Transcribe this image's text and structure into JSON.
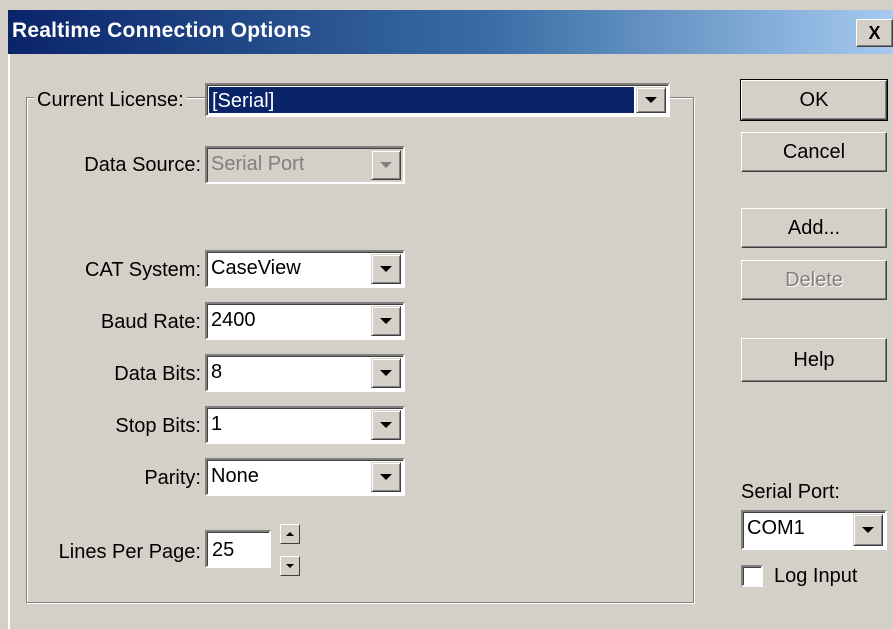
{
  "window": {
    "title": "Realtime Connection Options",
    "close_glyph": "X"
  },
  "license": {
    "label": "Current License:",
    "value": "[Serial]"
  },
  "data_source": {
    "label": "Data Source:",
    "value": "Serial Port"
  },
  "cat_system": {
    "label": "CAT System:",
    "value": "CaseView"
  },
  "baud_rate": {
    "label": "Baud Rate:",
    "value": "2400"
  },
  "data_bits": {
    "label": "Data Bits:",
    "value": "8"
  },
  "stop_bits": {
    "label": "Stop Bits:",
    "value": "1"
  },
  "parity": {
    "label": "Parity:",
    "value": "None"
  },
  "lines_per_page": {
    "label": "Lines Per Page:",
    "value": "25"
  },
  "buttons": {
    "ok": "OK",
    "cancel": "Cancel",
    "add": "Add...",
    "delete": "Delete",
    "help": "Help"
  },
  "serial_port": {
    "label": "Serial Port:",
    "value": "COM1"
  },
  "log_input": {
    "label": "Log Input",
    "checked": false
  },
  "colors": {
    "title_start": "#0a246a",
    "title_end": "#a6caf0",
    "face": "#d4d0c8",
    "selection": "#0a246a"
  }
}
